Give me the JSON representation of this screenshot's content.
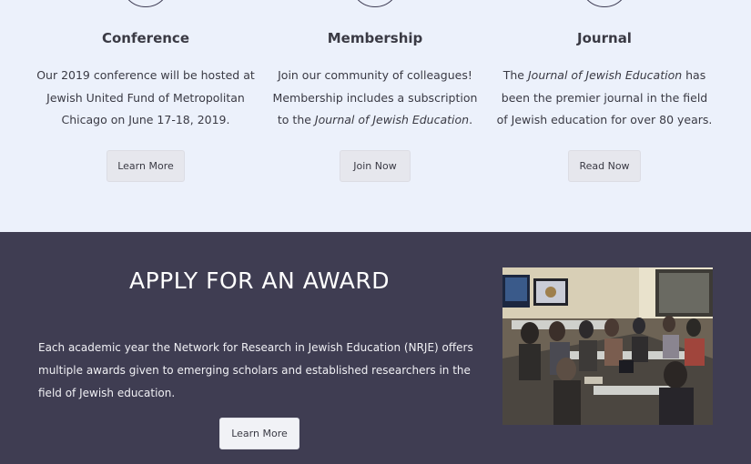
{
  "features": [
    {
      "title": "Conference",
      "desc": "Our 2019 conference will be hosted at Jewish United Fund of Metropolitan Chicago on June 17-18, 2019.",
      "button": "Learn More"
    },
    {
      "title": "Membership",
      "desc_before": "Join our community of colleagues! Membership includes a subscription to the ",
      "desc_em": "Journal of Jewish Education",
      "desc_after": ".",
      "button": "Join Now"
    },
    {
      "title": "Journal",
      "desc_before": "The ",
      "desc_em": "Journal of Jewish Education",
      "desc_after": " has been the premier journal in the field of Jewish education for over 80 years.",
      "button": "Read Now"
    }
  ],
  "award": {
    "title": "APPLY FOR AN AWARD",
    "text": "Each academic year the Network for Research in Jewish Education (NRJE) offers multiple awards given to emerging scholars and established researchers in the field of Jewish education.",
    "button": "Learn More"
  },
  "colors": {
    "top_bg": "#ecf1fb",
    "bottom_bg": "#3f3d52",
    "button_bg": "#e6e7ed"
  }
}
